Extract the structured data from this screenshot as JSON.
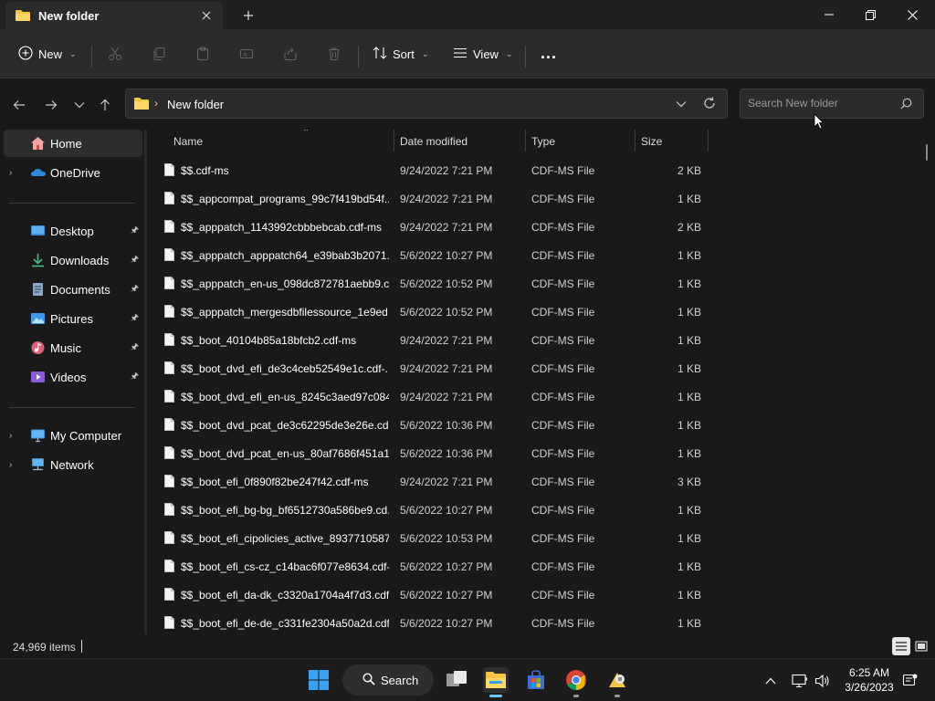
{
  "window": {
    "tab_title": "New folder",
    "new_tab_label": "+"
  },
  "toolbar": {
    "new_label": "New",
    "sort_label": "Sort",
    "view_label": "View",
    "more_label": "..."
  },
  "address": {
    "path_segment": "New folder"
  },
  "search": {
    "placeholder": "Search New folder"
  },
  "sidebar": {
    "items": [
      {
        "label": "Home"
      },
      {
        "label": "OneDrive"
      },
      {
        "label": "Desktop"
      },
      {
        "label": "Downloads"
      },
      {
        "label": "Documents"
      },
      {
        "label": "Pictures"
      },
      {
        "label": "Music"
      },
      {
        "label": "Videos"
      },
      {
        "label": "My Computer"
      },
      {
        "label": "Network"
      }
    ]
  },
  "columns": {
    "name": "Name",
    "date": "Date modified",
    "type": "Type",
    "size": "Size"
  },
  "files": [
    {
      "name": "$$.cdf-ms",
      "date": "9/24/2022 7:21 PM",
      "type": "CDF-MS File",
      "size": "2 KB"
    },
    {
      "name": "$$_appcompat_programs_99c7f419bd54f...",
      "date": "9/24/2022 7:21 PM",
      "type": "CDF-MS File",
      "size": "1 KB"
    },
    {
      "name": "$$_apppatch_1143992cbbbebcab.cdf-ms",
      "date": "9/24/2022 7:21 PM",
      "type": "CDF-MS File",
      "size": "2 KB"
    },
    {
      "name": "$$_apppatch_apppatch64_e39bab3b2071...",
      "date": "5/6/2022 10:27 PM",
      "type": "CDF-MS File",
      "size": "1 KB"
    },
    {
      "name": "$$_apppatch_en-us_098dc872781aebb9.c...",
      "date": "5/6/2022 10:52 PM",
      "type": "CDF-MS File",
      "size": "1 KB"
    },
    {
      "name": "$$_apppatch_mergesdbfilessource_1e9ed...",
      "date": "5/6/2022 10:52 PM",
      "type": "CDF-MS File",
      "size": "1 KB"
    },
    {
      "name": "$$_boot_40104b85a18bfcb2.cdf-ms",
      "date": "9/24/2022 7:21 PM",
      "type": "CDF-MS File",
      "size": "1 KB"
    },
    {
      "name": "$$_boot_dvd_efi_de3c4ceb52549e1c.cdf-...",
      "date": "9/24/2022 7:21 PM",
      "type": "CDF-MS File",
      "size": "1 KB"
    },
    {
      "name": "$$_boot_dvd_efi_en-us_8245c3aed97c084...",
      "date": "9/24/2022 7:21 PM",
      "type": "CDF-MS File",
      "size": "1 KB"
    },
    {
      "name": "$$_boot_dvd_pcat_de3c62295de3e26e.cd...",
      "date": "5/6/2022 10:36 PM",
      "type": "CDF-MS File",
      "size": "1 KB"
    },
    {
      "name": "$$_boot_dvd_pcat_en-us_80af7686f451a1...",
      "date": "5/6/2022 10:36 PM",
      "type": "CDF-MS File",
      "size": "1 KB"
    },
    {
      "name": "$$_boot_efi_0f890f82be247f42.cdf-ms",
      "date": "9/24/2022 7:21 PM",
      "type": "CDF-MS File",
      "size": "3 KB"
    },
    {
      "name": "$$_boot_efi_bg-bg_bf6512730a586be9.cd...",
      "date": "5/6/2022 10:27 PM",
      "type": "CDF-MS File",
      "size": "1 KB"
    },
    {
      "name": "$$_boot_efi_cipolicies_active_8937710587...",
      "date": "5/6/2022 10:53 PM",
      "type": "CDF-MS File",
      "size": "1 KB"
    },
    {
      "name": "$$_boot_efi_cs-cz_c14bac6f077e8634.cdf-...",
      "date": "5/6/2022 10:27 PM",
      "type": "CDF-MS File",
      "size": "1 KB"
    },
    {
      "name": "$$_boot_efi_da-dk_c3320a1704a4f7d3.cdf...",
      "date": "5/6/2022 10:27 PM",
      "type": "CDF-MS File",
      "size": "1 KB"
    },
    {
      "name": "$$_boot_efi_de-de_c331fe2304a50a2d.cdf...",
      "date": "5/6/2022 10:27 PM",
      "type": "CDF-MS File",
      "size": "1 KB"
    }
  ],
  "status": {
    "item_count": "24,969 items"
  },
  "taskbar": {
    "search_label": "Search",
    "time": "6:25 AM",
    "date": "3/26/2023"
  },
  "colors": {
    "accent": "#60cdff",
    "folder": "#f4c542",
    "background": "#191919"
  }
}
